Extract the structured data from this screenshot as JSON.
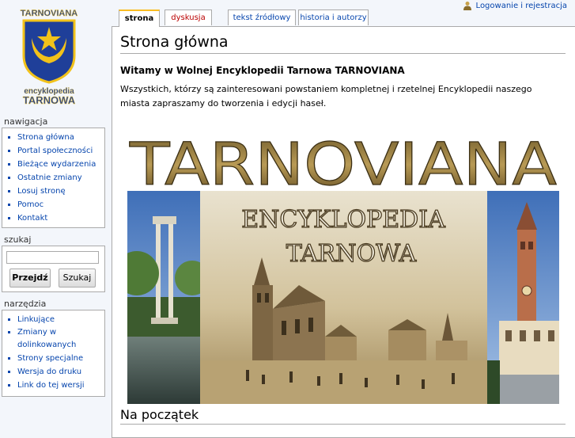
{
  "logo": {
    "top_text": "TARNOVIANA",
    "bottom_line1": "encyklopedia",
    "bottom_line2": "TARNOWA"
  },
  "personal": {
    "login_label": "Logowanie i rejestracja"
  },
  "tabs": [
    {
      "label": "strona",
      "active": true
    },
    {
      "label": "dyskusja",
      "red": true
    },
    {
      "label": "tekst źródłowy"
    },
    {
      "label": "historia i autorzy"
    }
  ],
  "content": {
    "title": "Strona główna",
    "welcome": "Witamy w Wolnej Encyklopedii Tarnowa TARNOVIANA",
    "intro": "Wszystkich, którzy są zainteresowani powstaniem kompletnej i rzetelnej Encyklopedii naszego miasta zapraszamy do tworzenia i edycji haseł.",
    "banner": {
      "title": "TARNOVIANA",
      "line1": "ENCYKLOPEDIA",
      "line2": "TARNOWA"
    },
    "section_title": "Na początek"
  },
  "sidebar": {
    "nav_title": "nawigacja",
    "nav_items": [
      "Strona główna",
      "Portal społeczności",
      "Bieżące wydarzenia",
      "Ostatnie zmiany",
      "Losuj stronę",
      "Pomoc",
      "Kontakt"
    ],
    "search_title": "szukaj",
    "search_value": "",
    "go_label": "Przejdź",
    "search_label": "Szukaj",
    "tools_title": "narzędzia",
    "tools_items": [
      "Linkujące",
      "Zmiany w dolinkowanych",
      "Strony specjalne",
      "Wersja do druku",
      "Link do tej wersji"
    ]
  },
  "colors": {
    "link": "#0645ad",
    "new_link": "#ba0000",
    "tab_accent": "#fabd23",
    "crest_blue": "#1f3f99",
    "crest_gold": "#f2c21a"
  },
  "icons": [
    "user-icon",
    "crest-logo",
    "star-icon",
    "crescent-icon"
  ]
}
